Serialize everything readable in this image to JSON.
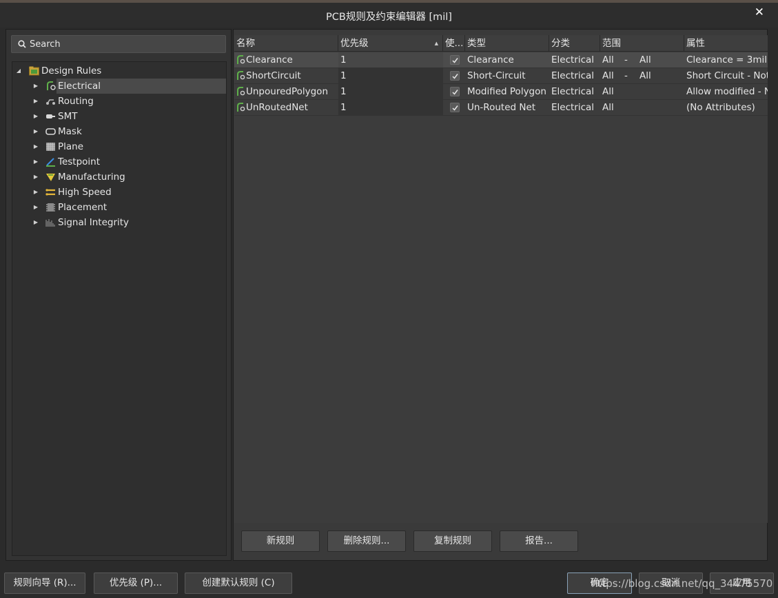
{
  "window": {
    "title": "PCB规则及约束编辑器 [mil]"
  },
  "search": {
    "placeholder": "Search"
  },
  "tree": {
    "root": {
      "label": "Design Rules",
      "expanded": true
    },
    "items": [
      {
        "label": "Electrical",
        "icon": "electrical-icon",
        "selected": true
      },
      {
        "label": "Routing",
        "icon": "routing-icon"
      },
      {
        "label": "SMT",
        "icon": "smt-icon"
      },
      {
        "label": "Mask",
        "icon": "mask-icon"
      },
      {
        "label": "Plane",
        "icon": "plane-icon"
      },
      {
        "label": "Testpoint",
        "icon": "testpoint-icon"
      },
      {
        "label": "Manufacturing",
        "icon": "manufacturing-icon"
      },
      {
        "label": "High Speed",
        "icon": "high-speed-icon"
      },
      {
        "label": "Placement",
        "icon": "placement-icon"
      },
      {
        "label": "Signal Integrity",
        "icon": "signal-integrity-icon"
      }
    ]
  },
  "grid": {
    "columns": [
      "名称",
      "优先级",
      "使...",
      "类型",
      "分类",
      "范围",
      "属性"
    ],
    "rows": [
      {
        "name": "Clearance",
        "priority": "1",
        "enabled": true,
        "type": "Clearance",
        "category": "Electrical",
        "scope1": "All",
        "dash": "-",
        "scope2": "All",
        "attributes": "Clearance = 3mil",
        "selected": true
      },
      {
        "name": "ShortCircuit",
        "priority": "1",
        "enabled": true,
        "type": "Short-Circuit",
        "category": "Electrical",
        "scope1": "All",
        "dash": "-",
        "scope2": "All",
        "attributes": "Short Circuit - Not Allowed"
      },
      {
        "name": "UnpouredPolygon",
        "priority": "1",
        "enabled": true,
        "type": "Modified Polygon",
        "category": "Electrical",
        "scope1": "All",
        "dash": "",
        "scope2": "",
        "attributes": "Allow modified - No"
      },
      {
        "name": "UnRoutedNet",
        "priority": "1",
        "enabled": true,
        "type": "Un-Routed Net",
        "category": "Electrical",
        "scope1": "All",
        "dash": "",
        "scope2": "",
        "attributes": "(No Attributes)"
      }
    ]
  },
  "panel_buttons": {
    "new_rule": "新规则",
    "delete_rule": "删除规则...",
    "copy_rule": "复制规则",
    "report": "报告..."
  },
  "footer": {
    "rule_wizard": "规则向导 (R)...",
    "priority": "优先级 (P)...",
    "create_default": "创建默认规则 (C)",
    "ok": "确定",
    "cancel": "取消",
    "apply": "应用"
  },
  "watermark": "https://blog.csdn.net/qq_34475570"
}
